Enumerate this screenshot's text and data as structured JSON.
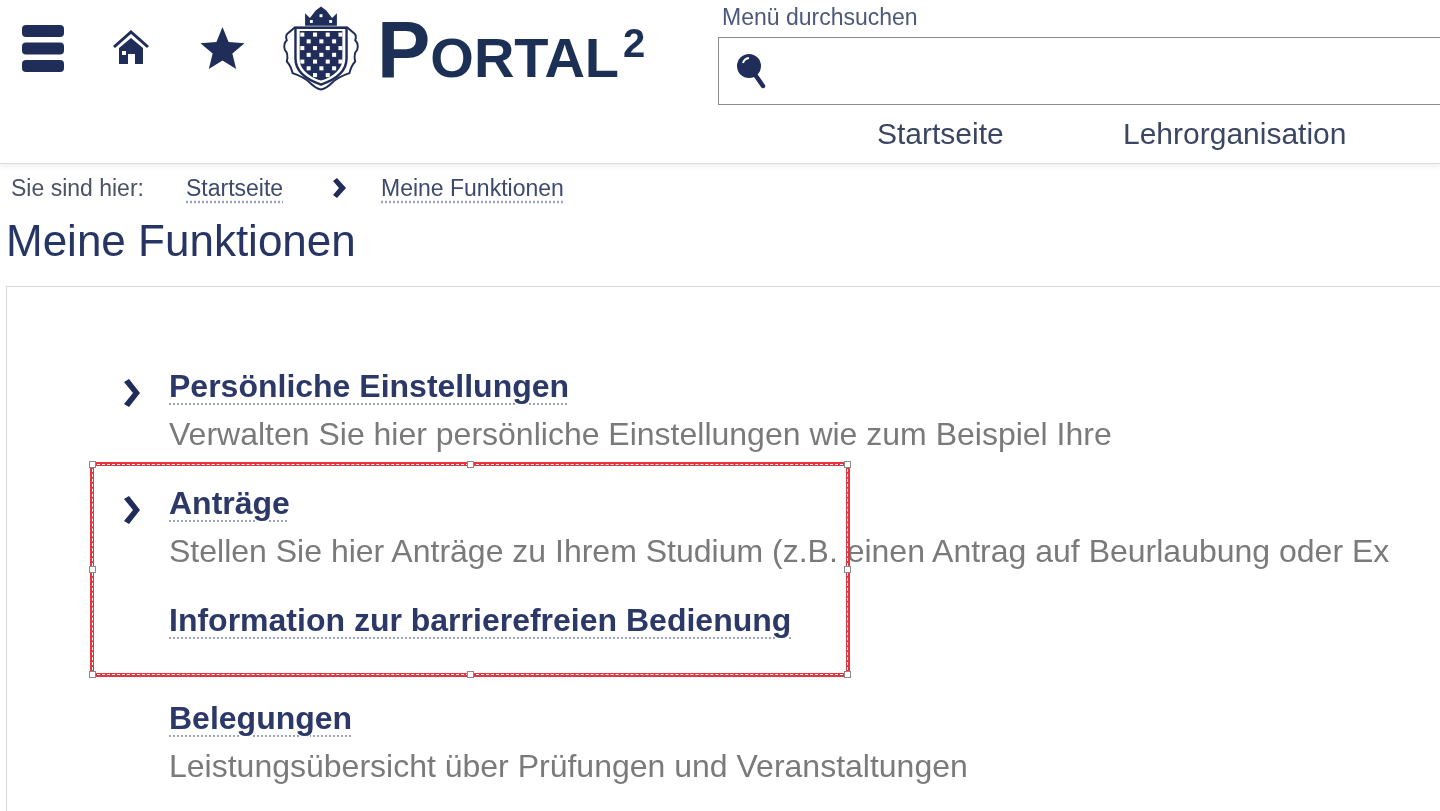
{
  "header": {
    "logo": {
      "text": "PORTAL$^{2}$"
    },
    "search": {
      "label": "Menü durchsuchen"
    },
    "nav": [
      {
        "label": "Startseite"
      },
      {
        "label": "Lehrorganisation"
      }
    ]
  },
  "breadcrumb": {
    "label": "Sie sind hier:",
    "items": [
      "Startseite",
      "Meine Funktionen"
    ]
  },
  "page_title": "Meine Funktionen",
  "functions": [
    {
      "title": "Persönliche Einstellungen",
      "description": "Verwalten Sie hier persönliche Einstellungen wie zum Beispiel Ihre",
      "expandable": true,
      "framed": false
    },
    {
      "title": "Anträge",
      "description": "Stellen Sie hier Anträge zu Ihrem Studium (z.B. einen Antrag auf Beurlaubung oder Ex",
      "expandable": true,
      "framed": true
    },
    {
      "title": "Information zur barrierefreien Bedienung",
      "expandable": false,
      "framed": true
    },
    {
      "title": "Belegungen",
      "description": "Leistungsübersicht über Prüfungen und Veranstaltungen",
      "expandable": false,
      "framed": false
    }
  ]
}
